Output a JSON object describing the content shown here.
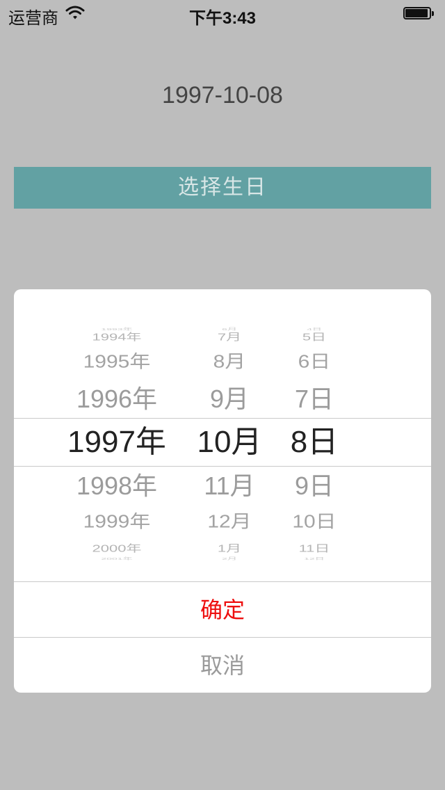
{
  "statusbar": {
    "carrier": "运营商",
    "time": "下午3:43",
    "icons": [
      "wifi-icon",
      "battery-icon"
    ]
  },
  "main": {
    "selected_date": "1997-10-08",
    "choose_button_label": "选择生日"
  },
  "picker": {
    "years": [
      "1993年",
      "1994年",
      "1995年",
      "1996年",
      "1997年",
      "1998年",
      "1999年",
      "2000年",
      "2001年"
    ],
    "months": [
      "6月",
      "7月",
      "8月",
      "9月",
      "10月",
      "11月",
      "12月",
      "1月",
      "2月"
    ],
    "days": [
      "4日",
      "5日",
      "6日",
      "7日",
      "8日",
      "9日",
      "10日",
      "11日",
      "12日"
    ],
    "selected": {
      "year": "1997年",
      "month": "10月",
      "day": "8日"
    }
  },
  "actions": {
    "confirm_label": "确定",
    "cancel_label": "取消"
  },
  "colors": {
    "background": "#bdbdbd",
    "button": "#62a1a3",
    "confirm": "#ee0f0f",
    "cancel": "#9a9a9a"
  }
}
